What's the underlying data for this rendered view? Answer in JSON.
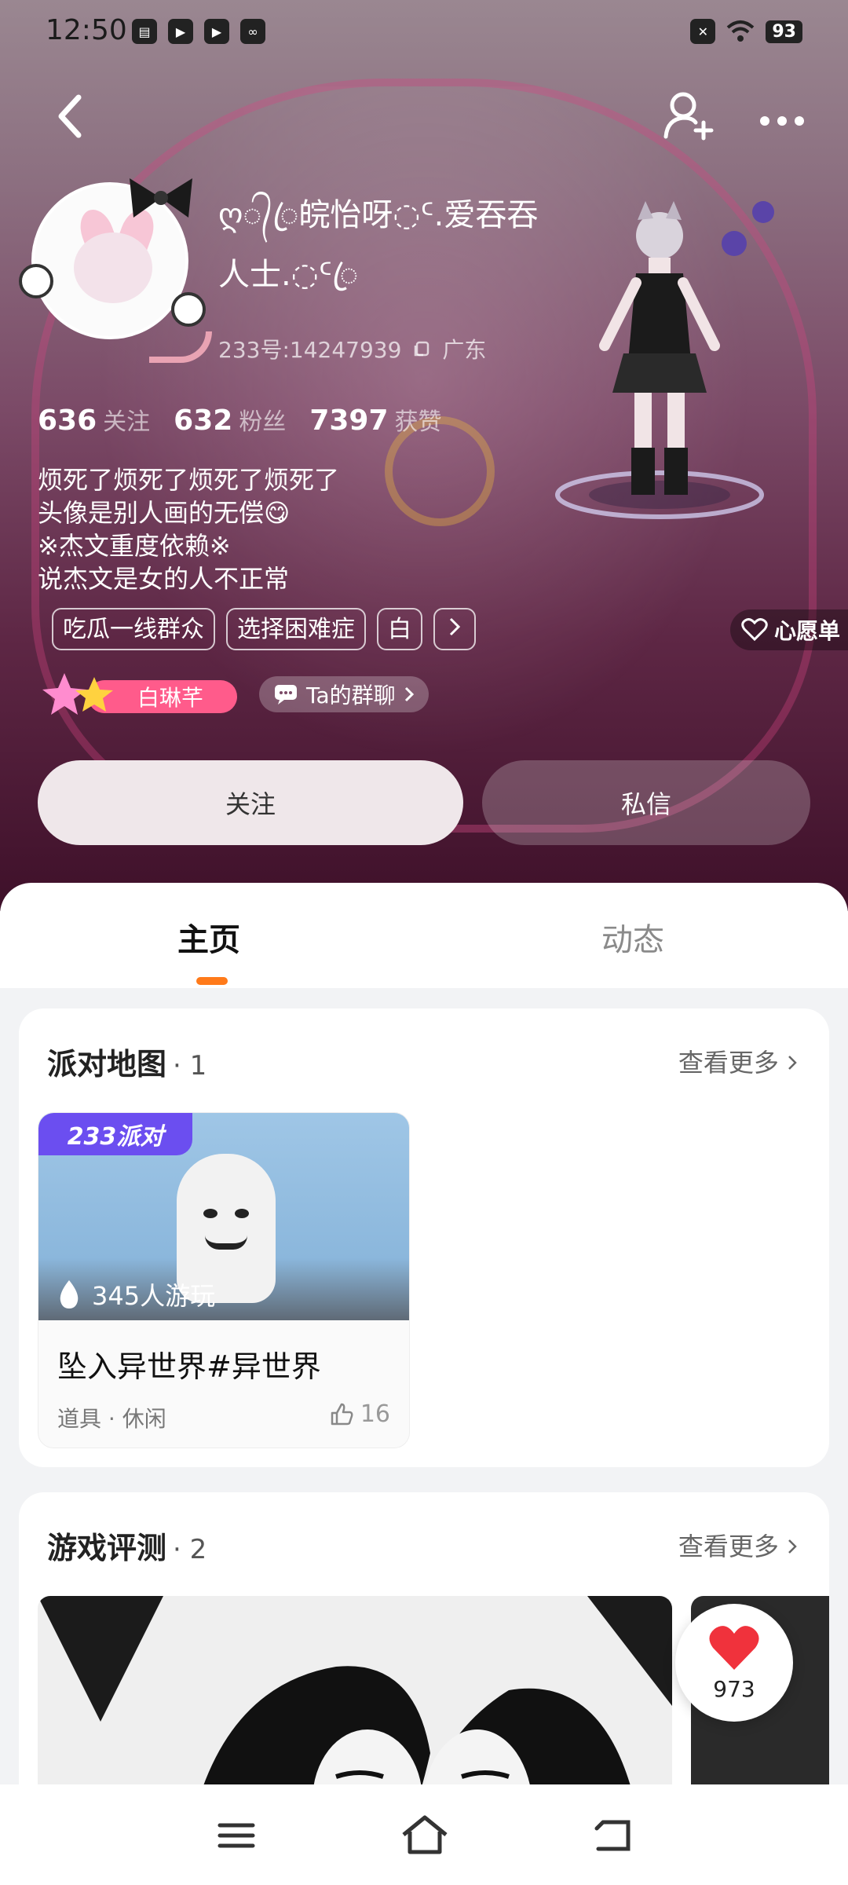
{
  "status_bar": {
    "time": "12:50",
    "battery": "93"
  },
  "profile": {
    "username": "ღ᭄ꦿ皖怡呀◌ᑦ.爱吞吞人士.◌ᑦꦿ",
    "uid_label": "233号:14247939",
    "location": "广东",
    "stats": [
      {
        "value": "636",
        "label": "关注"
      },
      {
        "value": "632",
        "label": "粉丝"
      },
      {
        "value": "7397",
        "label": "获赞"
      }
    ],
    "bio_lines": [
      "烦死了烦死了烦死了烦死了",
      "头像是别人画的无偿😋",
      "※杰文重度依赖※",
      "说杰文是女的人不正常"
    ],
    "tags": [
      "吃瓜一线群众",
      "选择困难症",
      "白"
    ],
    "wishlist_label": "心愿单",
    "friend_badge_label": "白琳芊",
    "group_chat_label": "Ta的群聊",
    "follow_label": "关注",
    "message_label": "私信"
  },
  "tabs": [
    {
      "label": "主页",
      "active": true
    },
    {
      "label": "动态",
      "active": false
    }
  ],
  "party_maps": {
    "title": "派对地图",
    "count": "· 1",
    "more_label": "查看更多",
    "items": [
      {
        "brand": "233派对",
        "players": "345人游玩",
        "name": "坠入异世界#异世界",
        "meta": "道具 · 休闲",
        "likes": "16"
      }
    ]
  },
  "game_reviews": {
    "title": "游戏评测",
    "count": "· 2",
    "more_label": "查看更多"
  },
  "heart_fab": {
    "count": "973"
  },
  "colors": {
    "accent": "#ff7a1a",
    "badge_pink": "#ff5b8b",
    "brand_purple": "#6b4ef0"
  }
}
